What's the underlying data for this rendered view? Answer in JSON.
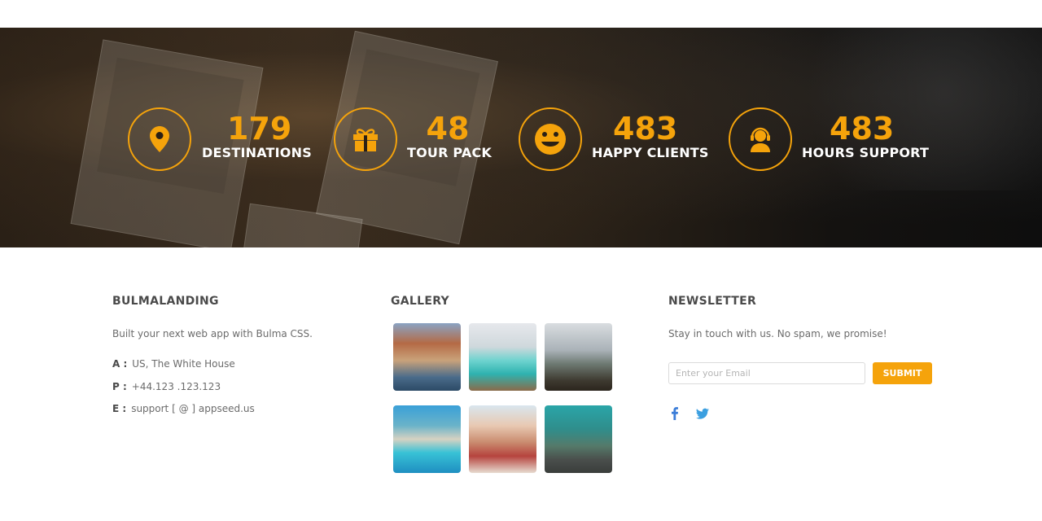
{
  "stats": [
    {
      "number": "179",
      "label": "DESTINATIONS",
      "icon": "map-pin-icon"
    },
    {
      "number": "48",
      "label": "TOUR PACK",
      "icon": "gift-icon"
    },
    {
      "number": "483",
      "label": "HAPPY CLIENTS",
      "icon": "smiley-icon"
    },
    {
      "number": "483",
      "label": "HOURS SUPPORT",
      "icon": "headset-support-icon"
    }
  ],
  "footer": {
    "about": {
      "title": "BULMALANDING",
      "description": "Built your next web app with Bulma CSS.",
      "address_key": "A :",
      "address": "US, The White House",
      "phone_key": "P :",
      "phone": "+44.123 .123.123",
      "email_key": "E :",
      "email": "support [ @ ] appseed.us"
    },
    "gallery": {
      "title": "GALLERY",
      "images": [
        "town-harbor-photo",
        "resort-pool-photo",
        "mountain-bench-photo",
        "blue-lagoon-photo",
        "cafe-girl-photo",
        "open-road-photo"
      ]
    },
    "newsletter": {
      "title": "NEWSLETTER",
      "description": "Stay in touch with us. No spam, we promise!",
      "email_placeholder": "Enter your Email",
      "submit_label": "SUBMIT",
      "social": [
        "facebook-icon",
        "twitter-icon"
      ]
    }
  },
  "colors": {
    "accent": "#f5a30b",
    "social_blue": "#3b7dd8",
    "heading": "#4a4a4a"
  }
}
